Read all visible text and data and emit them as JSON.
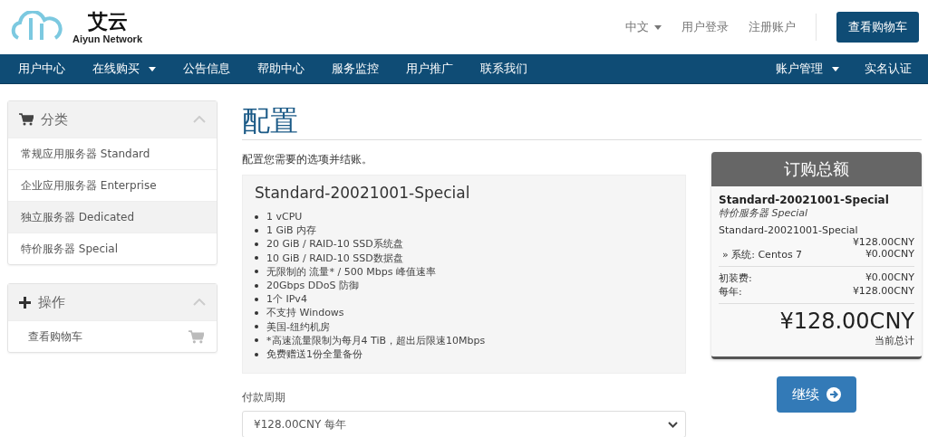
{
  "logo": {
    "title": "艾云",
    "subtitle": "Aiyun Network"
  },
  "top_links": [
    {
      "label": "中文",
      "dropdown": true
    },
    {
      "label": "用户登录",
      "dropdown": false
    },
    {
      "label": "注册账户",
      "dropdown": false
    }
  ],
  "cart_button": "查看购物车",
  "nav_left": [
    {
      "label": "用户中心",
      "dropdown": false
    },
    {
      "label": "在线购买",
      "dropdown": true
    },
    {
      "label": "公告信息",
      "dropdown": false
    },
    {
      "label": "帮助中心",
      "dropdown": false
    },
    {
      "label": "服务监控",
      "dropdown": false
    },
    {
      "label": "用户推广",
      "dropdown": false
    },
    {
      "label": "联系我们",
      "dropdown": false
    }
  ],
  "nav_right": [
    {
      "label": "账户管理",
      "dropdown": true
    },
    {
      "label": "实名认证",
      "dropdown": false
    }
  ],
  "sidebar": [
    {
      "kind": "categories",
      "title": "分类",
      "items": [
        {
          "label": "常规应用服务器 Standard",
          "selected": false
        },
        {
          "label": "企业应用服务器 Enterprise",
          "selected": false
        },
        {
          "label": "独立服务器 Dedicated",
          "selected": true
        },
        {
          "label": "特价服务器 Special",
          "selected": false
        }
      ]
    },
    {
      "kind": "actions",
      "title": "操作",
      "items": [
        {
          "label": "查看购物车",
          "selected": false
        }
      ]
    }
  ],
  "page_title": "配置",
  "intro": "配置您需要的选项并结账。",
  "product": {
    "name": "Standard-20021001-Special",
    "features": [
      "1 vCPU",
      "1 GiB 内存",
      "20 GiB / RAID-10 SSD系统盘",
      "10 GiB / RAID-10 SSD数据盘",
      "无限制的 流量* / 500 Mbps 峰值速率",
      "20Gbps DDoS 防御",
      "1个 IPv4",
      "不支持 Windows",
      "美国-纽约机房",
      "*高速流量限制为每月4 TiB，超出后限速10Mbps",
      "免费赠送1份全量备份"
    ]
  },
  "billing": {
    "label": "付款周期",
    "value": "¥128.00CNY 每年"
  },
  "summary": {
    "title": "订购总额",
    "product_name": "Standard-20021001-Special",
    "group": "特价服务器 Special",
    "line_name": "Standard-20021001-Special",
    "line_price": "¥128.00CNY",
    "option_label": "» 系统: Centos 7",
    "option_price": "¥0.00CNY",
    "fees": [
      {
        "label": "初装费:",
        "value": "¥0.00CNY"
      },
      {
        "label": "每年:",
        "value": "¥128.00CNY"
      }
    ],
    "total": "¥128.00CNY",
    "total_label": "当前总计"
  },
  "continue_button": "继续"
}
